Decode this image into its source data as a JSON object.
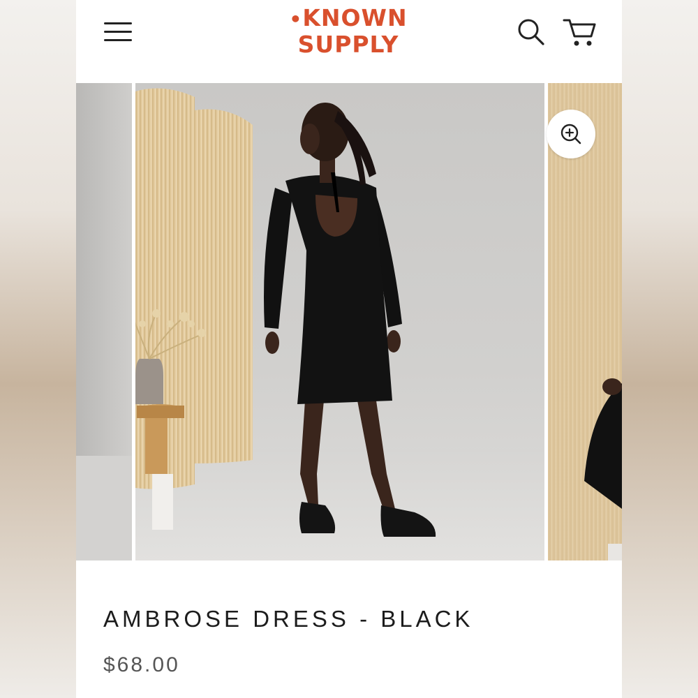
{
  "header": {
    "logo_dot": "•",
    "logo_line1": "KNOWN",
    "logo_line2": "SUPPLY",
    "menu_icon": "hamburger-menu-icon",
    "search_icon": "search-icon",
    "cart_icon": "cart-icon"
  },
  "gallery": {
    "zoom_icon": "zoom-in-icon"
  },
  "product": {
    "title": "AMBROSE DRESS - BLACK",
    "price": "$68.00"
  },
  "colors": {
    "brand": "#d9502d",
    "text": "#1c1c1c",
    "price": "#555555"
  }
}
